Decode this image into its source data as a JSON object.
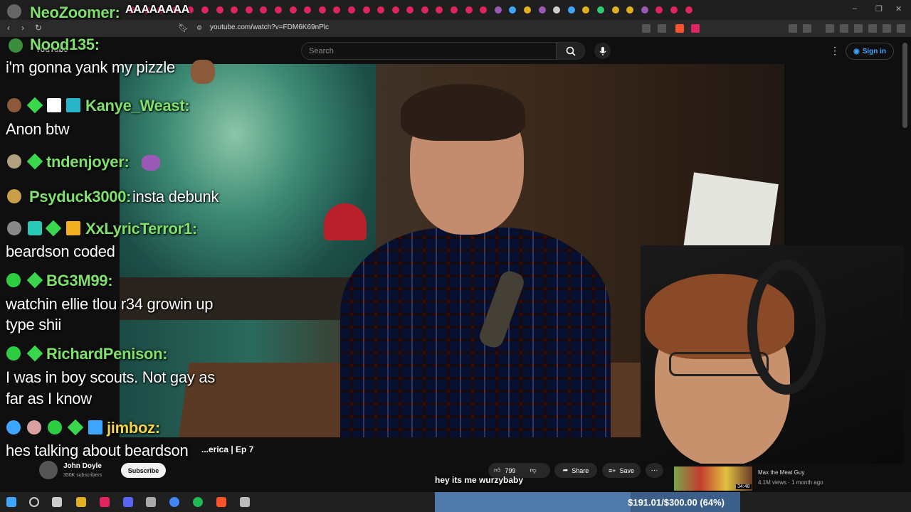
{
  "browser": {
    "tab_dot_colors": [
      "#e0245e",
      "#e0245e",
      "#e0245e",
      "#e0245e",
      "#e0245e",
      "#e0245e",
      "#e0245e",
      "#e0245e",
      "#e0245e",
      "#e0245e",
      "#e0245e",
      "#e0245e",
      "#e0245e",
      "#e0245e",
      "#e0245e",
      "#e0245e",
      "#e0245e",
      "#e0245e",
      "#e0245e",
      "#e0245e",
      "#e0245e",
      "#e0245e",
      "#e0245e",
      "#e0245e",
      "#e0245e",
      "#9b59b6",
      "#3ea6ff",
      "#e0b020",
      "#9b59b6",
      "#cccccc",
      "#3ea6ff",
      "#e0b020",
      "#2ecc71",
      "#e0b020",
      "#e0b020",
      "#9b59b6",
      "#e0245e",
      "#e0245e",
      "#e0245e"
    ],
    "url": "youtube.com/watch?v=FDM6K69nPlc",
    "window_controls": [
      "–",
      "❐",
      "✕"
    ]
  },
  "youtube": {
    "logo_text": "YouTube",
    "search_placeholder": "Search",
    "sign_in": "Sign in",
    "video_title": "...erica | Ep 7",
    "channel_name": "John Doyle",
    "channel_subs": "350K subscribers",
    "subscribe": "Subscribe",
    "likes": "799",
    "share": "Share",
    "save": "Save",
    "caption": "hey its me wurzybaby",
    "rec": {
      "title": "Max the Meat Guy",
      "meta": "4.1M views · 1 month ago",
      "duration": "34:48"
    }
  },
  "chat": {
    "header_user": "NeoZoomer:",
    "header_text": "AAAAAAAA",
    "messages": [
      {
        "user": "Nood135:",
        "text": "i'm gonna yank my pizzle",
        "user_color": "#7fe06b"
      },
      {
        "user": "Kanye_Weast:",
        "text": "Anon btw",
        "user_color": "#7fe06b"
      },
      {
        "user": "tndenjoyer:",
        "text": "",
        "user_color": "#7fe06b"
      },
      {
        "user": "Psyduck3000:",
        "text": "insta debunk",
        "user_color": "#7fe06b"
      },
      {
        "user": "XxLyricTerror1:",
        "text": "beardson coded",
        "user_color": "#7fe06b"
      },
      {
        "user": "BG3M99:",
        "text": "watchin ellie tlou r34 growin up",
        "text2": "type shii",
        "user_color": "#7fe06b"
      },
      {
        "user": "RichardPenison:",
        "text": "I was in boy scouts. Not gay as",
        "text2": "far as I know",
        "user_color": "#7fe06b"
      },
      {
        "user": "jimboz:",
        "text": "hes talking about beardson",
        "user_color": "#f2d34a"
      }
    ]
  },
  "goal": {
    "text": "$191.01/$300.00 (64%)",
    "fraction": 0.64
  },
  "taskbar": {
    "icon_colors": [
      "#3ea6ff",
      "#cccccc",
      "#cccccc",
      "#e0b020",
      "#e0245e",
      "#5865f2",
      "#aaaaaa",
      "#4285f4",
      "#1db954",
      "#fb542b",
      "#bbbbbb"
    ]
  }
}
